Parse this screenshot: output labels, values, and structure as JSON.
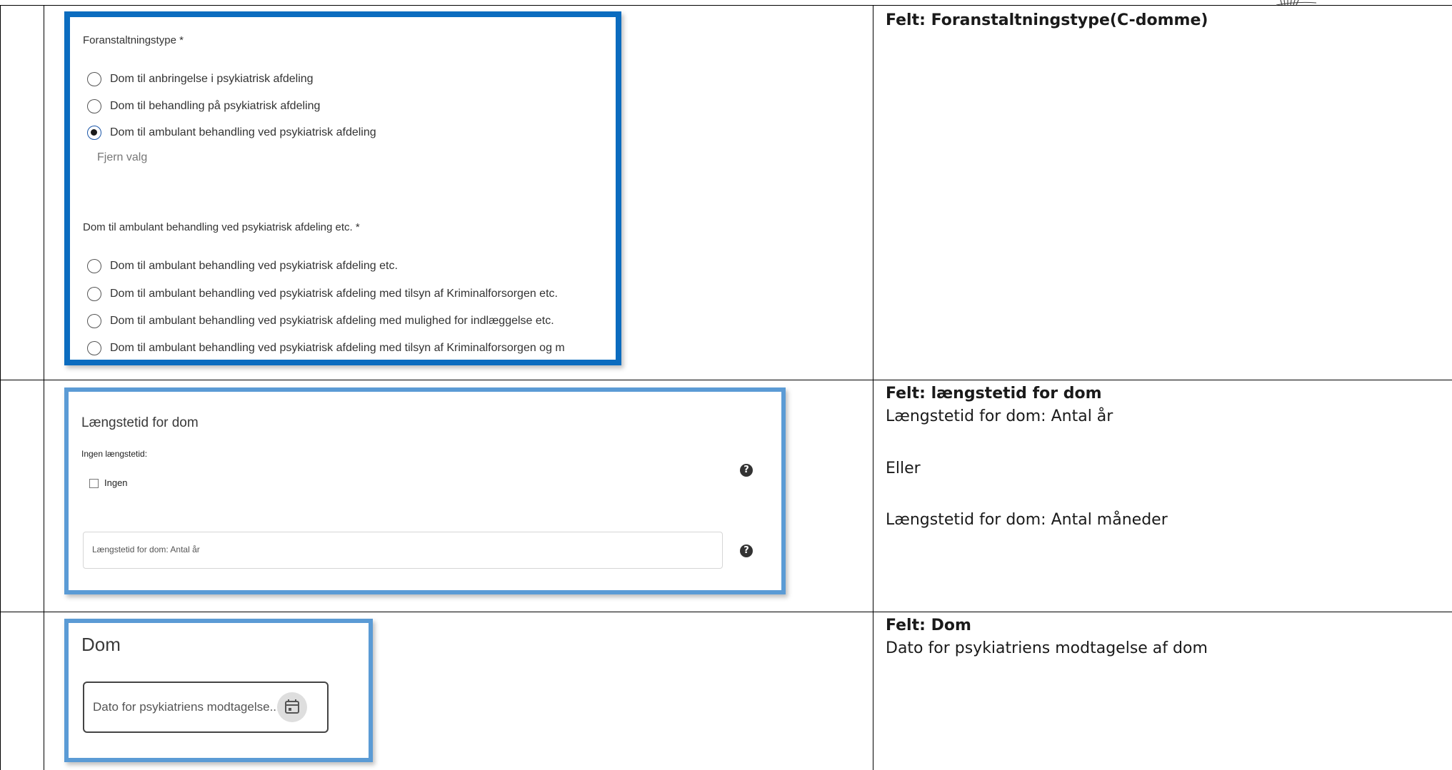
{
  "rows": [
    {
      "heading": "Felt: Foranstaltningstype(C-domme)",
      "lines": []
    },
    {
      "heading": "Felt: længstetid for dom",
      "lines": [
        "Længstetid for dom: Antal år",
        "Eller",
        "Længstetid for dom: Antal måneder"
      ]
    },
    {
      "heading": "Felt: Dom",
      "lines": [
        "Dato for psykiatriens modtagelse af dom"
      ]
    }
  ],
  "panel1": {
    "group1_label": "Foranstaltningstype  *",
    "group1_options": [
      "Dom til anbringelse i psykiatrisk afdeling",
      "Dom til behandling på psykiatrisk afdeling",
      "Dom til ambulant behandling ved psykiatrisk afdeling"
    ],
    "group1_selected_index": 2,
    "clear_label": "Fjern valg",
    "group2_label": "Dom til ambulant behandling ved psykiatrisk afdeling etc.  *",
    "group2_options": [
      "Dom til ambulant behandling ved psykiatrisk afdeling etc.",
      "Dom til ambulant behandling ved psykiatrisk afdeling med tilsyn af Kriminalforsorgen etc.",
      "Dom til ambulant behandling ved psykiatrisk afdeling med mulighed for indlæggelse etc.",
      "Dom til ambulant behandling ved psykiatrisk afdeling med tilsyn af Kriminalforsorgen og m"
    ]
  },
  "panel2": {
    "title": "Længstetid for dom",
    "no_max_label": "Ingen længstetid:",
    "checkbox_label": "Ingen",
    "input_placeholder": "Længstetid for dom: Antal år",
    "help_glyph": "?"
  },
  "panel3": {
    "title": "Dom",
    "date_placeholder": "Dato for psykiatriens modtagelse...",
    "icon": "calendar-icon"
  },
  "colors": {
    "panel1_border": "#0b6cbf",
    "panel_border": "#5b9bd5"
  }
}
